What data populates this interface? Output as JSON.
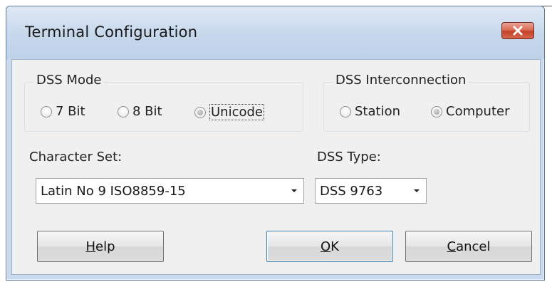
{
  "window": {
    "title": "Terminal Configuration",
    "close_icon": "close-icon"
  },
  "dss_mode": {
    "title": "DSS Mode",
    "options": [
      {
        "label": "7 Bit",
        "checked": false
      },
      {
        "label": "8 Bit",
        "checked": false
      },
      {
        "label": "Unicode",
        "checked": true
      }
    ]
  },
  "dss_interconnection": {
    "title": "DSS Interconnection",
    "options": [
      {
        "label": "Station",
        "checked": false
      },
      {
        "label": "Computer",
        "checked": true
      }
    ]
  },
  "character_set": {
    "label": "Character Set:",
    "value": "Latin No 9  ISO8859-15"
  },
  "dss_type": {
    "label": "DSS Type:",
    "value": "DSS 9763"
  },
  "buttons": {
    "help": {
      "mnemonic": "H",
      "rest": "elp"
    },
    "ok": {
      "mnemonic": "O",
      "rest": "K"
    },
    "cancel": {
      "mnemonic": "C",
      "rest": "ancel"
    }
  },
  "colors": {
    "titlebar": "#c7d8ec",
    "client": "#f0f0f0",
    "close_button": "#c4412a"
  }
}
